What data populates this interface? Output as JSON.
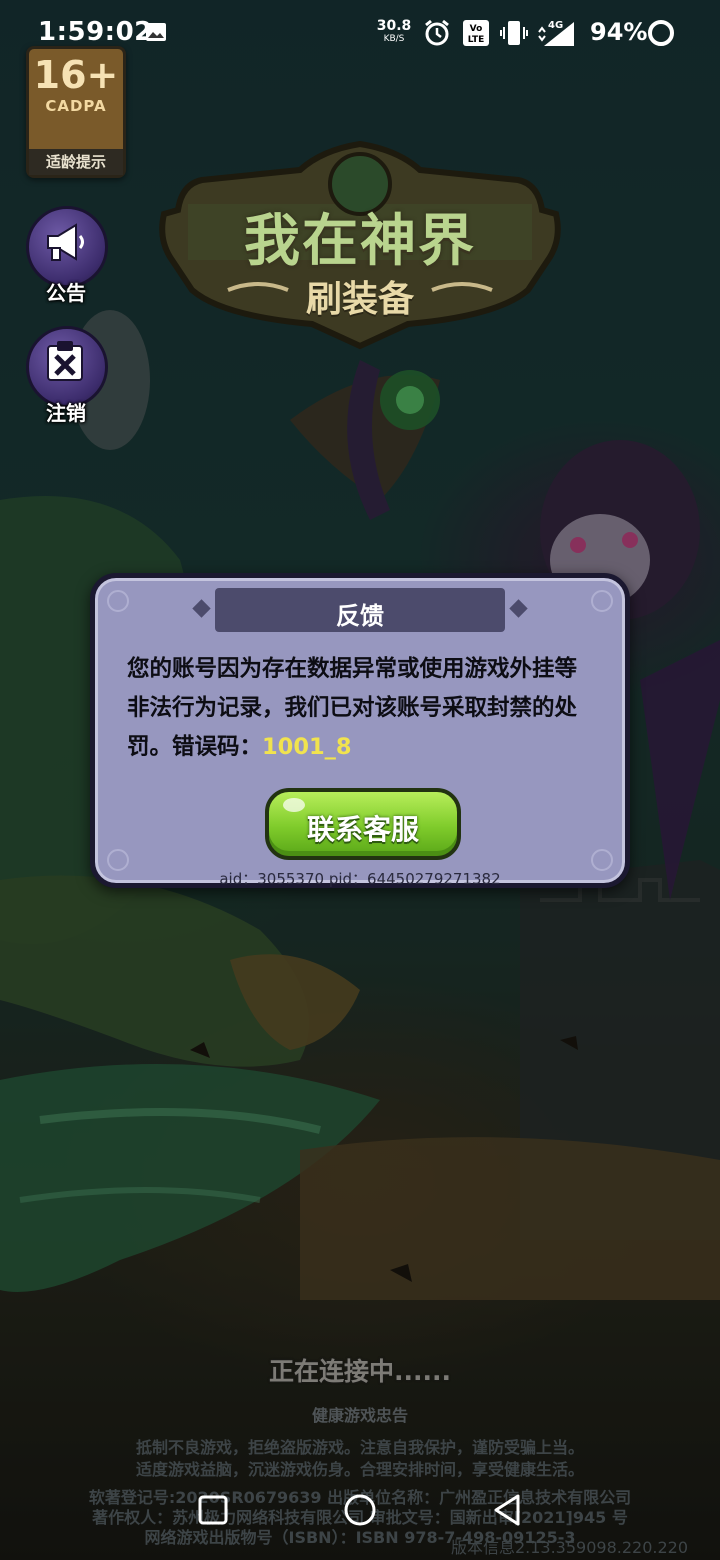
{
  "status_bar": {
    "time": "1:59:02",
    "net_speed_value": "30.8",
    "net_speed_unit": "KB/S",
    "network_type": "4G",
    "battery": "94%",
    "icons": [
      "gallery-icon",
      "alarm-icon",
      "volte-icon",
      "vibrate-icon",
      "signal-icon",
      "battery-icon"
    ]
  },
  "age_rating": {
    "age": "16+",
    "org": "CADPA",
    "label": "适龄提示"
  },
  "side_buttons": [
    {
      "label": "公告",
      "icon": "megaphone-icon"
    },
    {
      "label": "注销",
      "icon": "cancel-account-icon"
    }
  ],
  "logo": {
    "title": "我在神界",
    "subtitle": "刷装备"
  },
  "dialog": {
    "title": "反馈",
    "message": "您的账号因为存在数据异常或使用游戏外挂等非法行为记录，我们已对该账号采取封禁的处罚。错误码：",
    "error_code": "1001_8",
    "button_label": "联系客服",
    "ids": "aid：3055370  pid：64450279271382"
  },
  "bottom": {
    "connecting": "正在连接中......",
    "health_title": "健康游戏忠告",
    "health_lines": [
      "抵制不良游戏，拒绝盗版游戏。注意自我保护，谨防受骗上当。",
      "适度游戏益脑，沉迷游戏伤身。合理安排时间，享受健康生活。"
    ],
    "legal_lines": [
      "软著登记号:2020SR0679639 出版单位名称：广州盈正信息技术有限公司",
      "著作权人：苏州极力网络科技有限公司 审批文号：国新出审[2021]945 号",
      "网络游戏出版物号（ISBN）：ISBN 978-7-498-09125-3"
    ],
    "version": "版本信息2.13.359098.220.220"
  },
  "nav_bar": {
    "buttons": [
      "recents-button",
      "home-button",
      "back-button"
    ]
  },
  "colors": {
    "dialog_bg": "#9797bf",
    "dialog_title_bar": "#4c4b6c",
    "button_green": "#7fcb2b",
    "error_code": "#f1e34e"
  }
}
